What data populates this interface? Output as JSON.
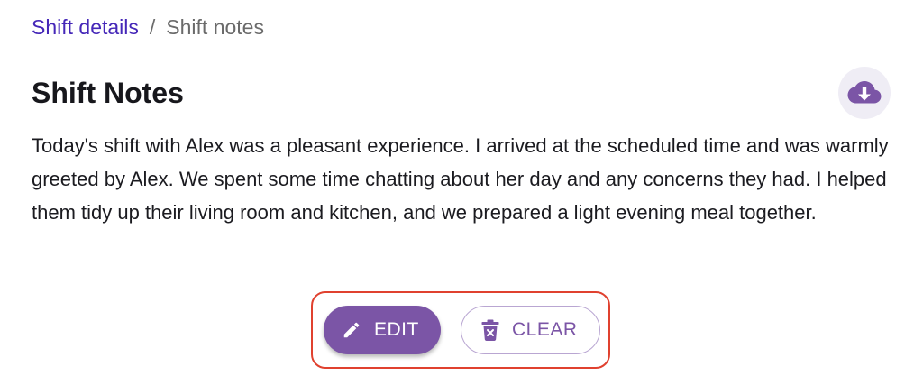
{
  "breadcrumb": {
    "parent": "Shift details",
    "separator": "/",
    "current": "Shift notes"
  },
  "header": {
    "title": "Shift Notes",
    "download_icon": "cloud-download-icon"
  },
  "notes": {
    "text": "Today's shift with Alex was a pleasant experience. I arrived at the scheduled time and was warmly greeted by Alex. We spent some time chatting about her day and any concerns they had. I helped them tidy up their living room and kitchen, and we prepared a light evening meal together."
  },
  "actions": {
    "edit_label": "EDIT",
    "edit_icon": "pencil-icon",
    "clear_label": "CLEAR",
    "clear_icon": "trash-icon"
  },
  "colors": {
    "accent": "#7b55a6",
    "link": "#4527b8",
    "highlight": "#e0412f"
  }
}
